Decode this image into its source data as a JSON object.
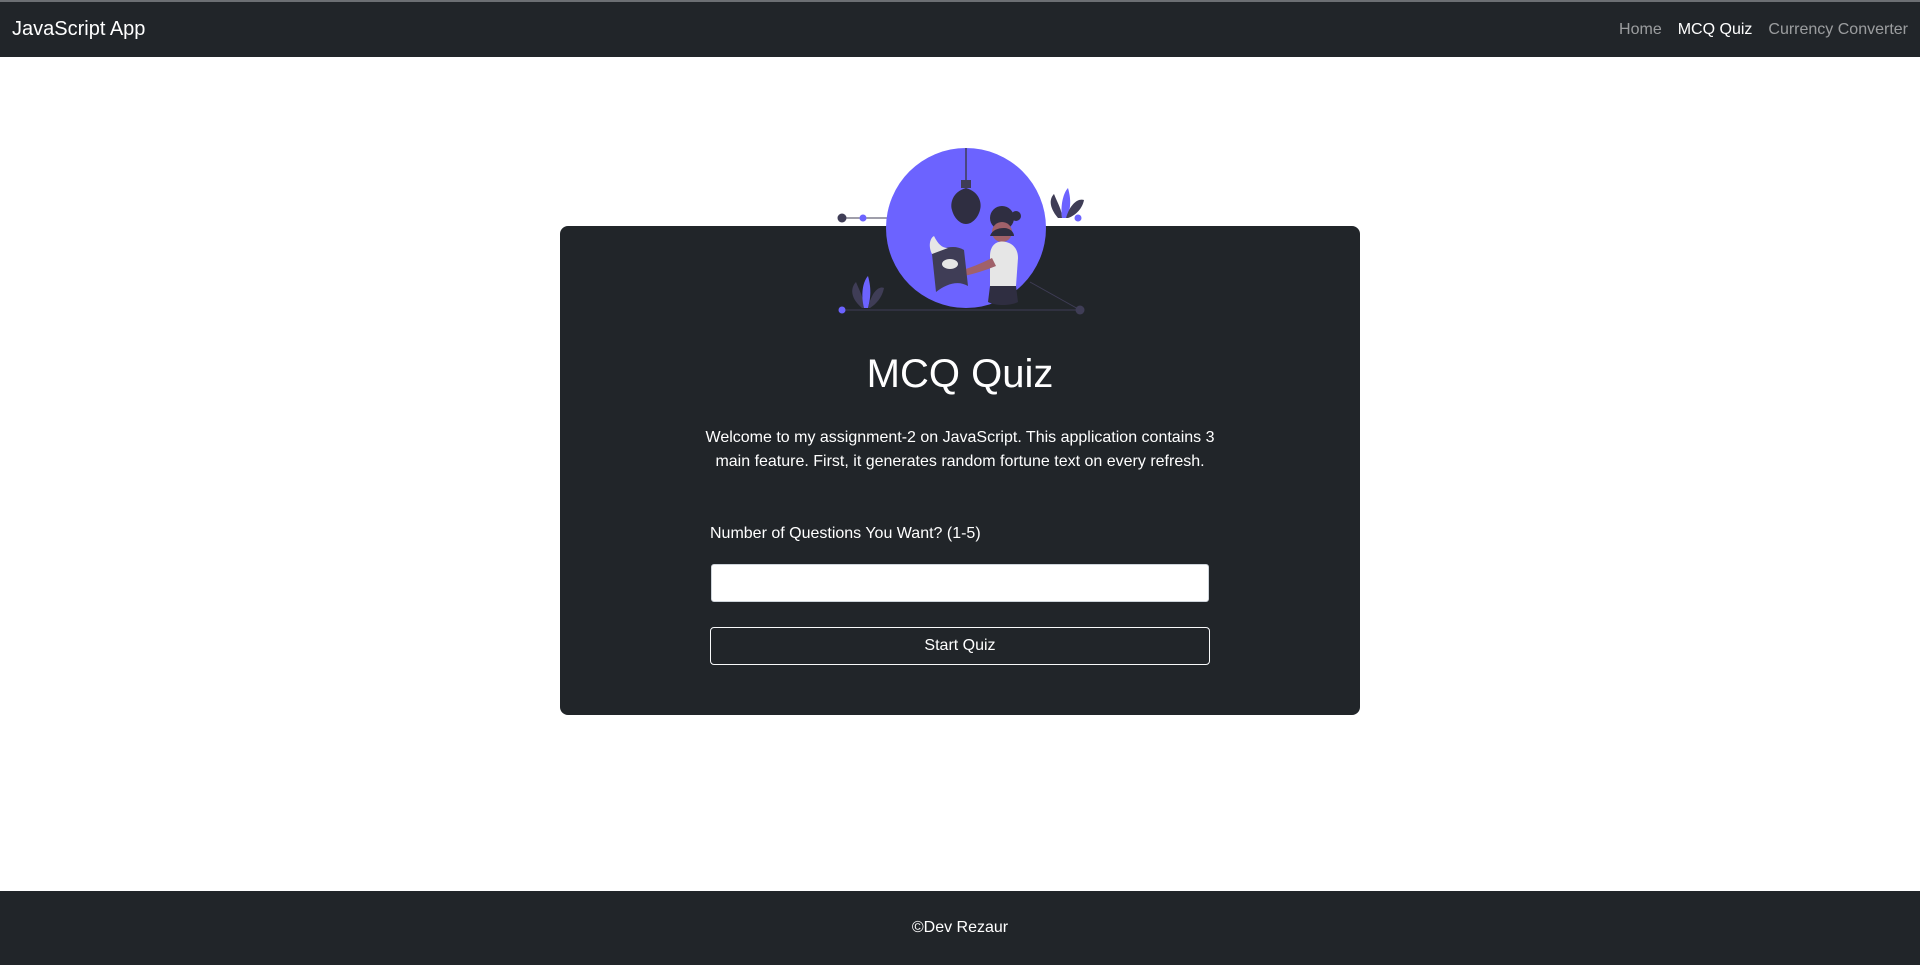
{
  "navbar": {
    "brand": "JavaScript App",
    "links": [
      {
        "label": "Home",
        "active": false
      },
      {
        "label": "MCQ Quiz",
        "active": true
      },
      {
        "label": "Currency Converter",
        "active": false
      }
    ]
  },
  "card": {
    "illustration": "person-reading-lightbulb-illustration",
    "title": "MCQ Quiz",
    "intro": "Welcome to my assignment-2 on JavaScript. This application contains 3 main feature. First, it generates random fortune text on every refresh.",
    "question_label": "Number of Questions You Want? (1-5)",
    "input_value": "",
    "input_placeholder": "",
    "start_button": "Start Quiz"
  },
  "footer": {
    "copyright": "©Dev Rezaur"
  },
  "colors": {
    "dark": "#212529",
    "accent": "#6c63ff",
    "white": "#ffffff"
  }
}
